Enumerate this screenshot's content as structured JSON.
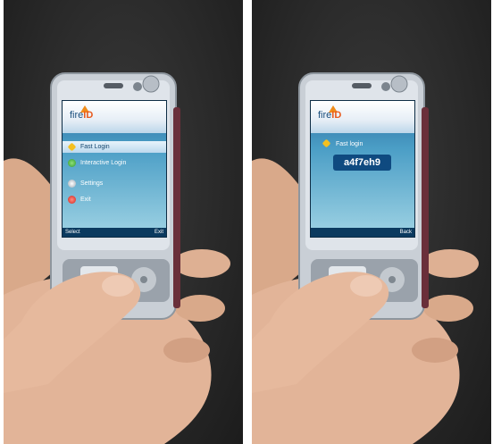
{
  "left_phone": {
    "logo_text": "fire",
    "logo_id": "ID",
    "menu": [
      {
        "label": "Fast Login",
        "icon": "star-icon"
      },
      {
        "label": "Interactive Login",
        "icon": "green-circle-icon"
      },
      {
        "label": "Settings",
        "icon": "gear-icon"
      },
      {
        "label": "Exit",
        "icon": "exit-icon"
      }
    ],
    "softkeys": {
      "left": "Select",
      "right": "Exit"
    }
  },
  "right_phone": {
    "logo_text": "fire",
    "logo_id": "ID",
    "title": "Fast login",
    "code": "a4f7eh9",
    "softkeys": {
      "left": "",
      "right": "Back"
    }
  }
}
